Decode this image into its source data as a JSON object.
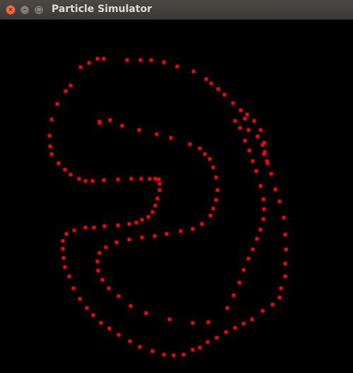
{
  "window": {
    "title": "Particle Simulator",
    "close_symbol": "×",
    "minimize_symbol": "–",
    "maximize_symbol": "□"
  },
  "simulation": {
    "background_color": "#000000",
    "particle_color": "#ff0000",
    "particle_count": 161
  }
}
